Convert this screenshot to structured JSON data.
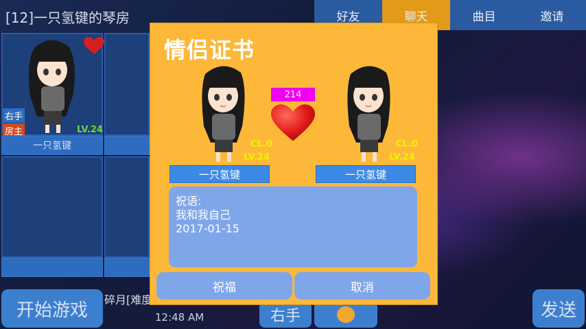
{
  "room": {
    "title": "[12]一只氢键的琴房"
  },
  "tabs": [
    {
      "label": "好友",
      "active": false
    },
    {
      "label": "聊天",
      "active": true
    },
    {
      "label": "曲目",
      "active": false
    },
    {
      "label": "邀请",
      "active": false
    }
  ],
  "player_slot": {
    "name": "一只氢键",
    "level": "LV.24",
    "tag_hand": "右手",
    "tag_owner": "房主"
  },
  "bottom": {
    "start_label": "开始游戏",
    "chat_snippet": "碎月[难度",
    "time": "12:48 AM",
    "hand_label": "右手",
    "send_label": "发送"
  },
  "dialog": {
    "title": "情侣证书",
    "score": "214",
    "left": {
      "name": "一只氢键",
      "cl": "CL.0",
      "lv": "LV.24"
    },
    "right": {
      "name": "一只氢键",
      "cl": "CL.0",
      "lv": "LV.24"
    },
    "message": {
      "label": "祝语:",
      "text": "我和我自己",
      "date": "2017-01-15"
    },
    "bless_label": "祝福",
    "cancel_label": "取消"
  },
  "colors": {
    "dialog_bg": "#fdb83a",
    "accent": "#3d8ae6",
    "score_bg": "#f000f0",
    "tab_active": "#e29a18"
  }
}
